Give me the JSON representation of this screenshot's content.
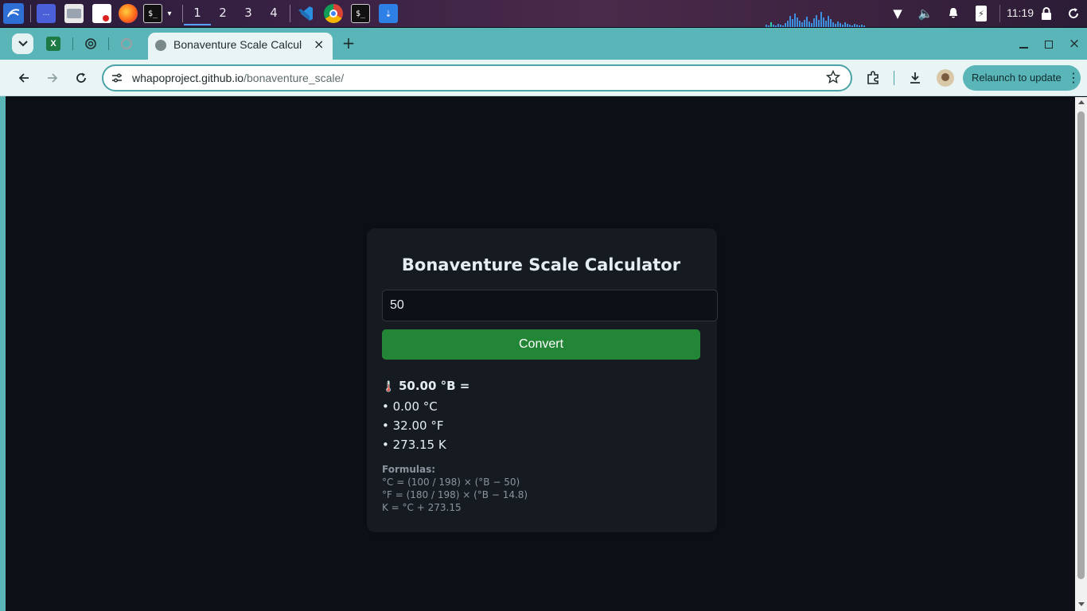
{
  "taskbar": {
    "workspaces": [
      "1",
      "2",
      "3",
      "4"
    ],
    "clock": "11:19",
    "icons": [
      "kali-menu-icon",
      "workspace-preview-icon",
      "file-manager-icon",
      "text-editor-icon",
      "firefox-icon",
      "terminal-icon",
      "vscode-icon",
      "chrome-icon",
      "terminal-icon",
      "downloads-folder-icon",
      "wifi-icon",
      "volume-icon",
      "notification-bell-icon",
      "battery-icon",
      "lock-icon",
      "refresh-icon"
    ]
  },
  "browser": {
    "tab_title": "Bonaventure Scale Calcul",
    "url_host": "whapoproject.github.io",
    "url_path": "/bonaventure_scale/",
    "relaunch_label": "Relaunch to update",
    "colors": {
      "frame": "#5ab5b8",
      "toolbar": "#e9f5f5"
    }
  },
  "page": {
    "title": "Bonaventure Scale Calculator",
    "input_value": "50",
    "convert_label": "Convert",
    "result": {
      "icon": "🌡️",
      "head": "50.00 °B =",
      "lines": [
        "• 0.00 °C",
        "• 32.00 °F",
        "• 273.15 K"
      ]
    },
    "formulas": {
      "head": "Formulas:",
      "lines": [
        "°C = (100 / 198) × (°B − 50)",
        "°F = (180 / 198) × (°B − 14.8)",
        "K = °C + 273.15"
      ]
    },
    "colors": {
      "background": "#0d1117",
      "card": "#161b22",
      "button": "#238636",
      "text": "#e6edf3",
      "muted": "#8b949e"
    }
  }
}
